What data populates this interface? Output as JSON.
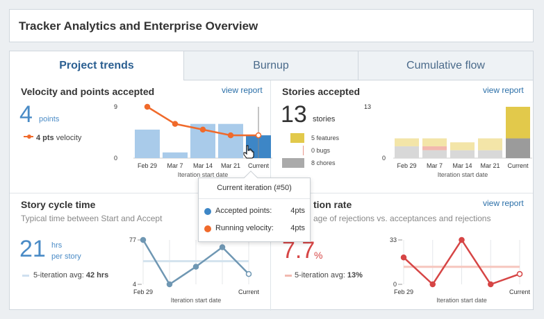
{
  "header": {
    "title": "Tracker Analytics and Enterprise Overview"
  },
  "tabs": [
    {
      "label": "Project trends",
      "active": true
    },
    {
      "label": "Burnup",
      "active": false
    },
    {
      "label": "Cumulative flow",
      "active": false
    }
  ],
  "colors": {
    "accent_blue": "#4a8bc6",
    "bar_blue_light": "#a9cbea",
    "bar_blue_current": "#3d86c6",
    "velocity_orange": "#f06a2b",
    "feature_yellow": "#e2c94b",
    "bug_red": "#e8958a",
    "chore_gray": "#aaaaaa",
    "cycle_line": "#6f97b3",
    "reject_red": "#d64545"
  },
  "velocity": {
    "title": "Velocity and points accepted",
    "view_report": "view report",
    "value": "4",
    "unit": "points",
    "legend_value": "4 pts",
    "legend_label": "velocity",
    "xlabel": "Iteration start date"
  },
  "stories": {
    "title": "Stories accepted",
    "view_report": "view report",
    "value": "13",
    "unit": "stories",
    "legend": [
      {
        "label": "5 features",
        "icon": "feature-swatch"
      },
      {
        "label": "0 bugs",
        "icon": "bug-swatch"
      },
      {
        "label": "8 chores",
        "icon": "chore-swatch"
      }
    ],
    "xlabel": "Iteration start date"
  },
  "cycle": {
    "title": "Story cycle time",
    "subtitle": "Typical time between Start and Accept",
    "value": "21",
    "unit_line1": "hrs",
    "unit_line2": "per story",
    "avg_label": "5-iteration avg:",
    "avg_value": "42 hrs",
    "xlabel": "Iteration start date"
  },
  "rejection": {
    "title_partial": "tion rate",
    "subtitle_partial": "age of rejections vs. acceptances and rejections",
    "view_report": "view report",
    "value": "7.7",
    "unit": "%",
    "avg_label": "5-iteration avg:",
    "avg_value": "13%",
    "xlabel": "Iteration start date"
  },
  "tooltip": {
    "title": "Current iteration (#50)",
    "rows": [
      {
        "label": "Accepted points:",
        "value": "4pts"
      },
      {
        "label": "Running velocity:",
        "value": "4pts"
      }
    ]
  },
  "chart_data": [
    {
      "type": "bar",
      "title": "Velocity and points accepted",
      "categories": [
        "Feb 29",
        "Mar 7",
        "Mar 14",
        "Mar 21",
        "Current"
      ],
      "series": [
        {
          "values": [
            5,
            1,
            6,
            6,
            4
          ]
        },
        {
          "values": [
            9,
            6,
            5,
            4,
            4
          ],
          "type": "line"
        }
      ],
      "xlabel": "Iteration start date",
      "ylim": [
        0,
        9
      ],
      "yticks": [
        "0",
        "9"
      ]
    },
    {
      "type": "bar",
      "title": "Stories accepted",
      "categories": [
        "Feb 29",
        "Mar 7",
        "Mar 14",
        "Mar 21",
        "Current"
      ],
      "series": [
        {
          "values": [
            2,
            2,
            2,
            3,
            8
          ]
        },
        {
          "values": [
            0,
            1,
            0,
            0,
            0
          ]
        },
        {
          "values": [
            3,
            2,
            2,
            2,
            5
          ]
        }
      ],
      "xlabel": "Iteration start date",
      "ylim": [
        0,
        13
      ],
      "yticks": [
        "0",
        "13"
      ]
    },
    {
      "type": "line",
      "title": "Story cycle time",
      "categories": [
        "Feb 29",
        "",
        "",
        "",
        "Current"
      ],
      "series": [
        {
          "values": [
            77,
            4,
            33,
            65,
            21
          ]
        }
      ],
      "average": 42,
      "xlabel": "Iteration start date",
      "ylim": [
        4,
        77
      ],
      "yticks": [
        "4",
        "77"
      ]
    },
    {
      "type": "line",
      "title": "tion rate",
      "categories": [
        "Feb 29",
        "",
        "",
        "",
        "Current"
      ],
      "series": [
        {
          "values": [
            20,
            0,
            33,
            0,
            7.7
          ]
        }
      ],
      "average": 13,
      "xlabel": "Iteration start date",
      "ylim": [
        0,
        33
      ],
      "yticks": [
        "0",
        "33"
      ]
    }
  ]
}
